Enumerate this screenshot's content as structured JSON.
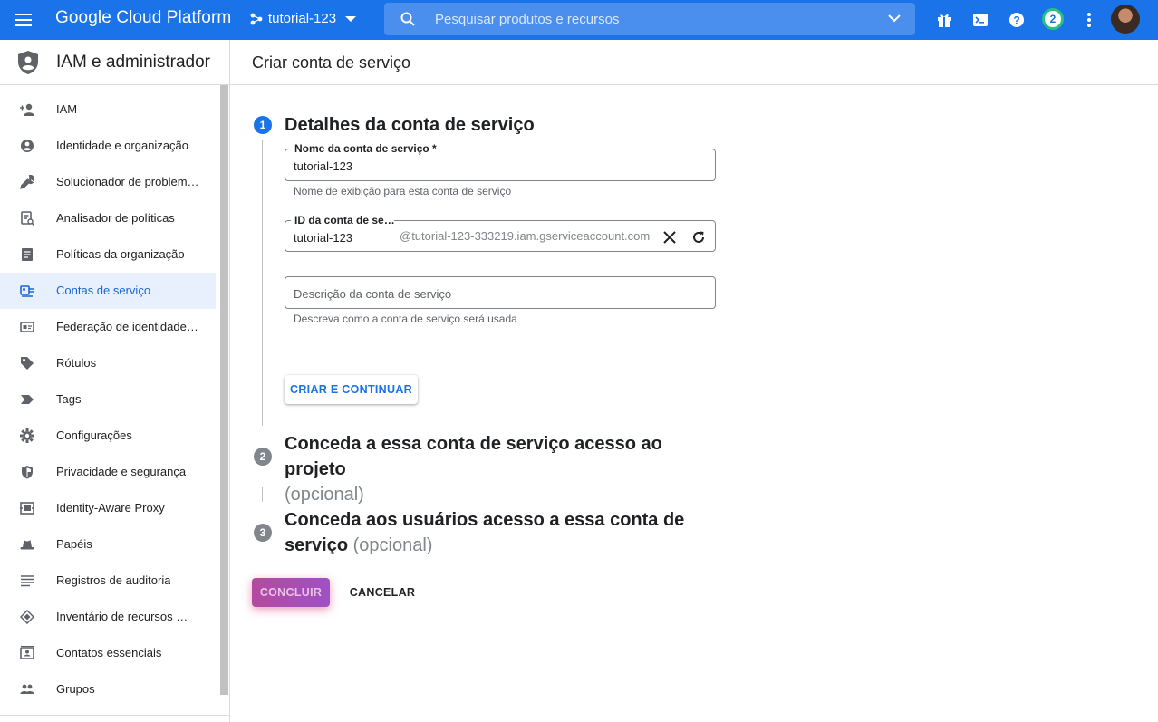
{
  "topbar": {
    "brand": "Google Cloud Platform",
    "project": "tutorial-123",
    "search_placeholder": "Pesquisar produtos e recursos",
    "notifications_count": "2",
    "color": "#1a73e8"
  },
  "sidebar": {
    "title": "IAM e administrador",
    "items": [
      {
        "label": "IAM",
        "icon": "person-add-icon"
      },
      {
        "label": "Identidade e organização",
        "icon": "account-circle-icon"
      },
      {
        "label": "Solucionador de problem…",
        "icon": "wrench-icon"
      },
      {
        "label": "Analisador de políticas",
        "icon": "policy-doc-icon"
      },
      {
        "label": "Políticas da organização",
        "icon": "list-doc-icon"
      },
      {
        "label": "Contas de serviço",
        "icon": "service-account-icon",
        "active": true
      },
      {
        "label": "Federação de identidade …",
        "icon": "id-card-icon"
      },
      {
        "label": "Rótulos",
        "icon": "label-icon"
      },
      {
        "label": "Tags",
        "icon": "tag-icon"
      },
      {
        "label": "Configurações",
        "icon": "gear-icon"
      },
      {
        "label": "Privacidade e segurança",
        "icon": "shield-icon"
      },
      {
        "label": "Identity-Aware Proxy",
        "icon": "proxy-icon"
      },
      {
        "label": "Papéis",
        "icon": "hat-icon"
      },
      {
        "label": "Registros de auditoria",
        "icon": "lines-icon"
      },
      {
        "label": "Inventário de recursos …",
        "icon": "layers-icon"
      },
      {
        "label": "Contatos essenciais",
        "icon": "contact-card-icon"
      },
      {
        "label": "Grupos",
        "icon": "group-icon"
      }
    ]
  },
  "main": {
    "page_title": "Criar conta de serviço",
    "step1": {
      "number": "1",
      "title": "Detalhes da conta de serviço",
      "name_label": "Nome da conta de serviço *",
      "name_value": "tutorial-123",
      "name_hint": "Nome de exibição para esta conta de serviço",
      "id_label": "ID da conta de se…",
      "id_value": "tutorial-123",
      "id_suffix": "@tutorial-123-333219.iam.gserviceaccount.com",
      "desc_placeholder": "Descrição da conta de serviço",
      "desc_hint": "Descreva como a conta de serviço será usada",
      "create_button": "CRIAR E CONTINUAR"
    },
    "step2": {
      "number": "2",
      "title": "Conceda a essa conta de serviço acesso ao projeto",
      "optional": "(opcional)"
    },
    "step3": {
      "number": "3",
      "title_line1": "Conceda aos usuários acesso a essa conta de",
      "title_line2": "serviço",
      "optional": "(opcional)"
    },
    "done_button": "CONCLUIR",
    "cancel_button": "CANCELAR"
  }
}
